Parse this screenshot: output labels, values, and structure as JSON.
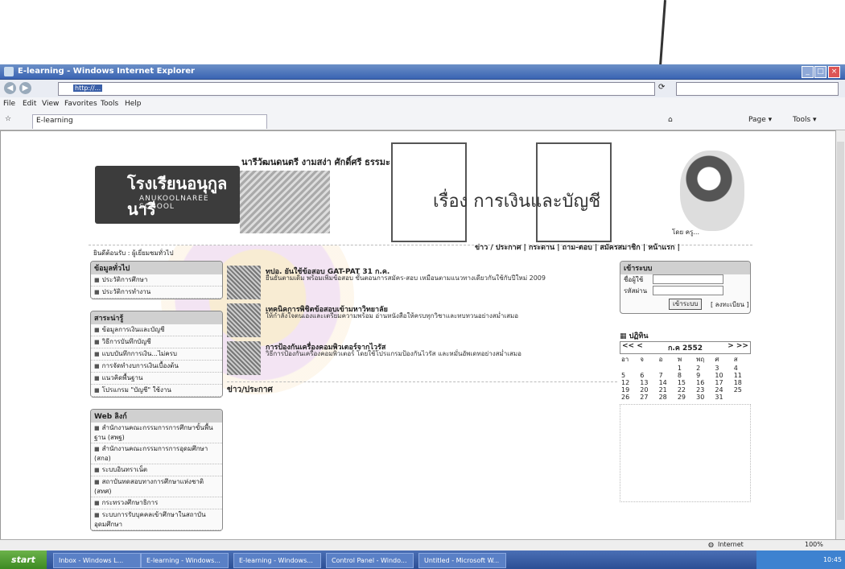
{
  "window": {
    "title": "E-learning - Windows Internet Explorer"
  },
  "browser": {
    "menu": [
      "File",
      "Edit",
      "View",
      "Favorites",
      "Tools",
      "Help"
    ],
    "tab_title": "E-learning",
    "toolbar_right": [
      "Page ▾",
      "Tools ▾"
    ],
    "status_zone": "Internet",
    "zoom": "100%"
  },
  "site": {
    "school_th": "โรงเรียนอนุกูลนารี",
    "school_en": "ANUKOOLNAREE SCHOOL",
    "slogan": "นารีวัฒนดนตรี งามสง่า ศักดิ์ศรี ธรรมะ",
    "course_title": "เรื่อง การเงินและบัญชี",
    "teacher_caption": "โดย ครู...",
    "top_menu": "ข่าว / ประกาศ | กระดาน | ถาม-ตอบ | สมัครสมาชิก | หน้าแรก |",
    "crumb": "ยินดีต้อนรับ : ผู้เยี่ยมชมทั่วไป"
  },
  "left": {
    "panels": [
      {
        "title": "ข้อมูลทั่วไป",
        "items": [
          "ประวัติการศึกษา",
          "ประวัติการทำงาน"
        ]
      },
      {
        "title": "สาระน่ารู้",
        "items": [
          "ข้อมูลการเงินและบัญชี",
          "วิธีการบันทึกบัญชี",
          "แบบบันทึกการเงิน...ไม่ครบ",
          "การจัดทำงบการเงินเบื้องต้น",
          "แนวคิดพื้นฐาน",
          "โปรแกรม \"บัญชี\" ใช้งาน"
        ]
      },
      {
        "title": "Web ลิงก์",
        "items": [
          "สำนักงานคณะกรรมการการศึกษาขั้นพื้นฐาน (สพฐ)",
          "สำนักงานคณะกรรมการการอุดมศึกษา (สกอ)",
          "ระบบอินทราเน็ต",
          "สถาบันทดสอบทางการศึกษาแห่งชาติ (สทศ)",
          "กระทรวงศึกษาธิการ",
          "ระบบการรับบุคคลเข้าศึกษาในสถาบันอุดมศึกษา"
        ]
      }
    ]
  },
  "news": [
    {
      "title": "ทปอ. ยันใช้ข้อสอบ GAT-PAT 31 ก.ค.",
      "text": "ยืนยันตามเดิม พร้อมเพิ่มข้อสอบ ขั้นตอนการสมัคร-สอบ เหมือนตามแนวทางเดียวกันใช้กับปีใหม่ 2009"
    },
    {
      "title": "เทคนิคการพิชิตข้อสอบเข้ามหาวิทยาลัย",
      "text": "ให้กำลังใจตนเองและเตรียมความพร้อม อ่านหนังสือให้ครบทุกวิชาและทบทวนอย่างสม่ำเสมอ"
    },
    {
      "title": "การป้องกันเครื่องคอมพิวเตอร์จากไวรัส",
      "text": "วิธีการป้องกันเครื่องคอมพิวเตอร์ โดยใช้โปรแกรมป้องกันไวรัส และหมั่นอัพเดทอย่างสม่ำเสมอ"
    }
  ],
  "news_more": "ข่าว/ประกาศ",
  "login": {
    "title": "เข้าระบบ",
    "user_label": "ชื่อผู้ใช้",
    "pass_label": "รหัสผ่าน",
    "button": "เข้าระบบ",
    "register": "[ ลงทะเบียน ]"
  },
  "calendar": {
    "title": "ปฏิทิน",
    "month": "ก.ค 2552",
    "prev": "<< <",
    "next": "> >>",
    "days": [
      "อา",
      "จ",
      "อ",
      "พ",
      "พฤ",
      "ศ",
      "ส"
    ],
    "weeks": [
      [
        "",
        "",
        "",
        "1",
        "2",
        "3",
        "4"
      ],
      [
        "5",
        "6",
        "7",
        "8",
        "9",
        "10",
        "11"
      ],
      [
        "12",
        "13",
        "14",
        "15",
        "16",
        "17",
        "18"
      ],
      [
        "19",
        "20",
        "21",
        "22",
        "23",
        "24",
        "25"
      ],
      [
        "26",
        "27",
        "28",
        "29",
        "30",
        "31",
        ""
      ]
    ]
  },
  "taskbar": {
    "start": "start",
    "buttons": [
      "Inbox - Windows L...",
      "E-learning - Windows...",
      "E-learning - Windows...",
      "Control Panel - Windo...",
      "Untitled - Microsoft W..."
    ],
    "tray": "10:45"
  }
}
